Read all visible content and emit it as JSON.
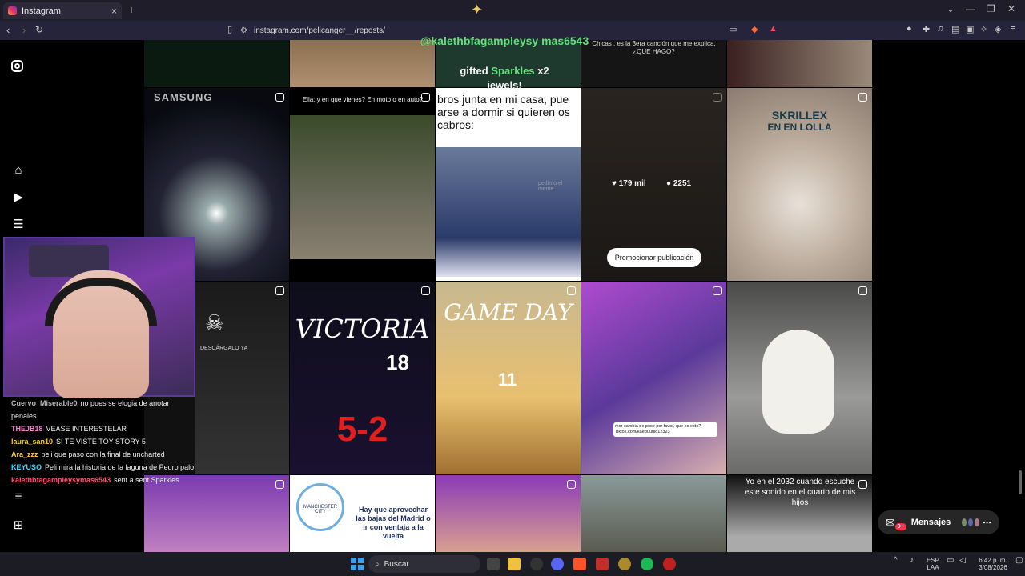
{
  "browser": {
    "tab_title": "Instagram",
    "tab_close": "×",
    "new_tab": "+",
    "url": "instagram.com/pelicanger__/reposts/",
    "window_controls": [
      "⌄",
      "—",
      "❐",
      "✕"
    ]
  },
  "overlay": {
    "gift_user": "@kalethbfagampleysy mas6543",
    "gift_line": "gifted",
    "gift_item": "Sparkles",
    "gift_count": "x2",
    "gift_tail": "jewels!"
  },
  "tiles": {
    "t4_caption": "Chicas , es la 3era canción que me explica, ¿QUE HAGO?",
    "t7_caption": "Ella: y en que vienes? En moto o en auto?",
    "t6_label": "SAMSUNG",
    "t8_text": "bros junta en mi casa, pue arse a dormir si quieren os cabros:",
    "t8_watermark": "pedimo el meme",
    "t9_likes": "179 mil",
    "t9_comments": "2251",
    "t9_promote": "Promocionar publicación",
    "t10_title": "SKRILLEX",
    "t10_sub": "EN EN LOLLA",
    "t12_label": "DESCÁRGALO YA",
    "t13_title": "VICTORIA",
    "t13_score": "5-2",
    "t13_number": "18",
    "t14_title": "GAME DAY",
    "t14_number": "11",
    "t15_banner": "mor cambia de pose por favor, que es esto? Tiktok.com/kaeduuuid12323",
    "t18_text": "Hay que aprovechar las bajas del Madrid o ir con ventaja a la vuelta",
    "t18_badge": "MANCHESTER CITY",
    "t21_text": "Yo en el 2032 cuando escuche este sonido en el cuarto de mis hijos"
  },
  "chat": [
    {
      "user": "Cuervo_Miserable0",
      "msg": "no pues se elogia de anotar penales",
      "color": "#bbbbbb"
    },
    {
      "user": "THEJB18",
      "msg": "VEASE INTERESTELAR",
      "color": "#ff7fd4"
    },
    {
      "user": "laura_san10",
      "msg": "SI TE VISTE TOY STORY 5",
      "color": "#ffcc33"
    },
    {
      "user": "Ara_zzz",
      "msg": "peli que paso con la final de uncharted",
      "color": "#ffcc33"
    },
    {
      "user": "KEYUSO",
      "msg": "Peli mira la historia de la laguna de Pedro palo",
      "color": "#33ddff"
    },
    {
      "user": "kalethbfagampleysymas6543",
      "msg": "sent a sent Sparkles",
      "color": "#ff5577"
    }
  ],
  "messages": {
    "label": "Mensajes",
    "badge": "9+"
  },
  "taskbar": {
    "search_label": "Buscar",
    "lang": "ESP",
    "region": "LAA",
    "time": "6:42 p. m.",
    "date": "3/08/2026"
  },
  "colors": {
    "accent": "#ff3040",
    "bg": "#000000",
    "chrome": "#1f1d2a"
  }
}
